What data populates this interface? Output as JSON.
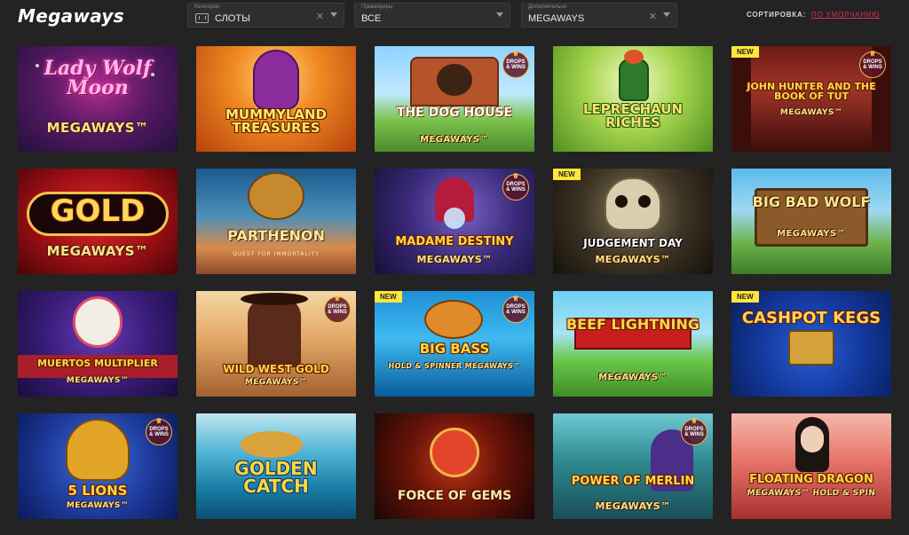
{
  "header": {
    "brand": "Megaways"
  },
  "filters": [
    {
      "label": "Категории",
      "value": "СЛОТЫ",
      "clear": "✕"
    },
    {
      "label": "Провайдеры",
      "value": "ВСЕ"
    },
    {
      "label": "Дополнительно",
      "value": "MEGAWAYS",
      "clear": "✕"
    }
  ],
  "sort": {
    "label": "СОРТИРОВКА:",
    "value": "ПО УМОЛЧАНИЮ"
  },
  "badges": {
    "new": "NEW",
    "drops_line1": "DROPS",
    "drops_line2": "& WINS"
  },
  "games": [
    {
      "title": "Lady Wolf Moon",
      "sub": "MEGAWAYS™"
    },
    {
      "title": "Mummyland Treasures",
      "sub": ""
    },
    {
      "title": "The Dog House",
      "sub": "MEGAWAYS™"
    },
    {
      "title": "Leprechaun Riches",
      "sub": ""
    },
    {
      "title": "John Hunter and the Book of Tut",
      "sub": "MEGAWAYS™"
    },
    {
      "title": "Gold",
      "sub": "MEGAWAYS™"
    },
    {
      "title": "Parthenon",
      "sub": "QUEST FOR IMMORTALITY"
    },
    {
      "title": "Madame Destiny",
      "sub": "MEGAWAYS™"
    },
    {
      "title": "Judgement Day",
      "sub": "MEGAWAYS™"
    },
    {
      "title": "Big Bad Wolf",
      "sub": "MEGAWAYS™"
    },
    {
      "title": "Muertos Multiplier",
      "sub": "MEGAWAYS™"
    },
    {
      "title": "Wild West Gold",
      "sub": "MEGAWAYS™"
    },
    {
      "title": "Big Bass",
      "sub": "HOLD & SPINNER MEGAWAYS™"
    },
    {
      "title": "Beef Lightning",
      "sub": "MEGAWAYS™"
    },
    {
      "title": "Cashpot Kegs",
      "sub": ""
    },
    {
      "title": "5 Lions",
      "sub": "MEGAWAYS™"
    },
    {
      "title": "Golden Catch",
      "sub": ""
    },
    {
      "title": "Force of Gems",
      "sub": ""
    },
    {
      "title": "Power of Merlin",
      "sub": "MEGAWAYS™"
    },
    {
      "title": "Floating Dragon",
      "sub": "MEGAWAYS™ HOLD & SPIN"
    }
  ],
  "colors": {
    "background": "#232323",
    "sort_accent": "#e3304f",
    "new_badge": "#ffe63b"
  }
}
